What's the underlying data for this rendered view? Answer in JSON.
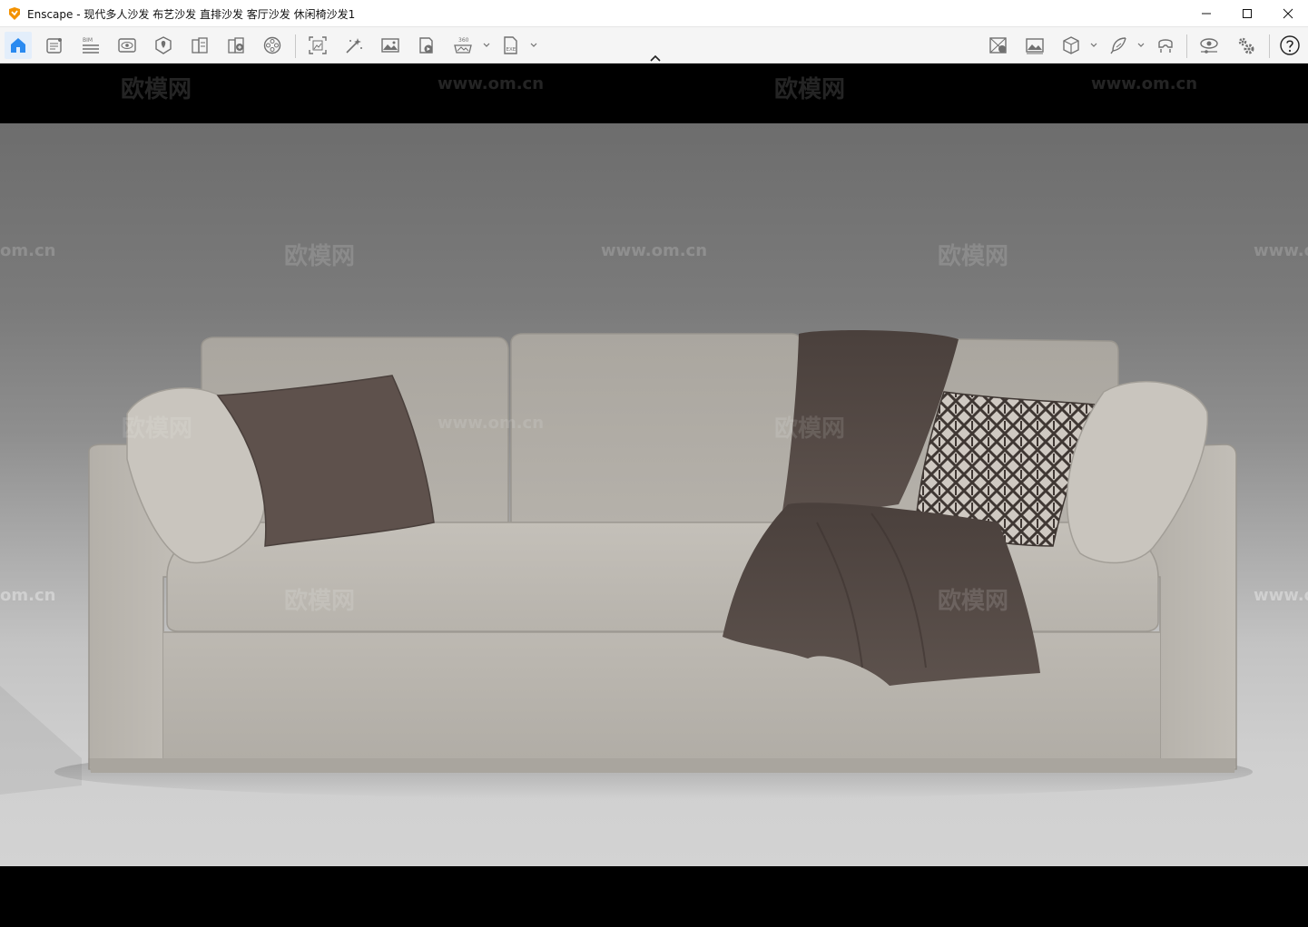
{
  "window": {
    "title": "Enscape - 现代多人沙发 布艺沙发 直排沙发 客厅沙发 休闲椅沙发1",
    "controls": [
      "minimize",
      "maximize",
      "close"
    ]
  },
  "toolbar": {
    "left_icons": [
      "home-icon",
      "project-notes-icon",
      "bim-icon",
      "views-icon",
      "site-context-icon",
      "material-library-icon",
      "asset-library-icon",
      "video-editor-icon",
      "batch-render-icon",
      "sketch-mode-icon",
      "render-image-icon",
      "render-video-icon",
      "render-360-icon",
      "export-exe-icon"
    ],
    "bim_label": "BIM",
    "pano_label": "360",
    "exe_label": "EXE",
    "right_icons": [
      "synchronize-views-icon",
      "capture-icon",
      "cube-view-icon",
      "feather-icon",
      "vr-headset-icon",
      "visual-settings-icon",
      "general-settings-icon",
      "help-icon"
    ],
    "active": "home-icon"
  },
  "colors": {
    "accent": "#2a8af0",
    "toolbar_icon": "#707070",
    "logo_orange": "#f39200"
  },
  "viewport": {
    "subject": "sofa-render",
    "watermark_brand": "欧模网",
    "watermark_url": "www.om.cn",
    "watermark_url_left_fragment": "om.cn",
    "watermark_url_right_fragment": "www.o"
  }
}
